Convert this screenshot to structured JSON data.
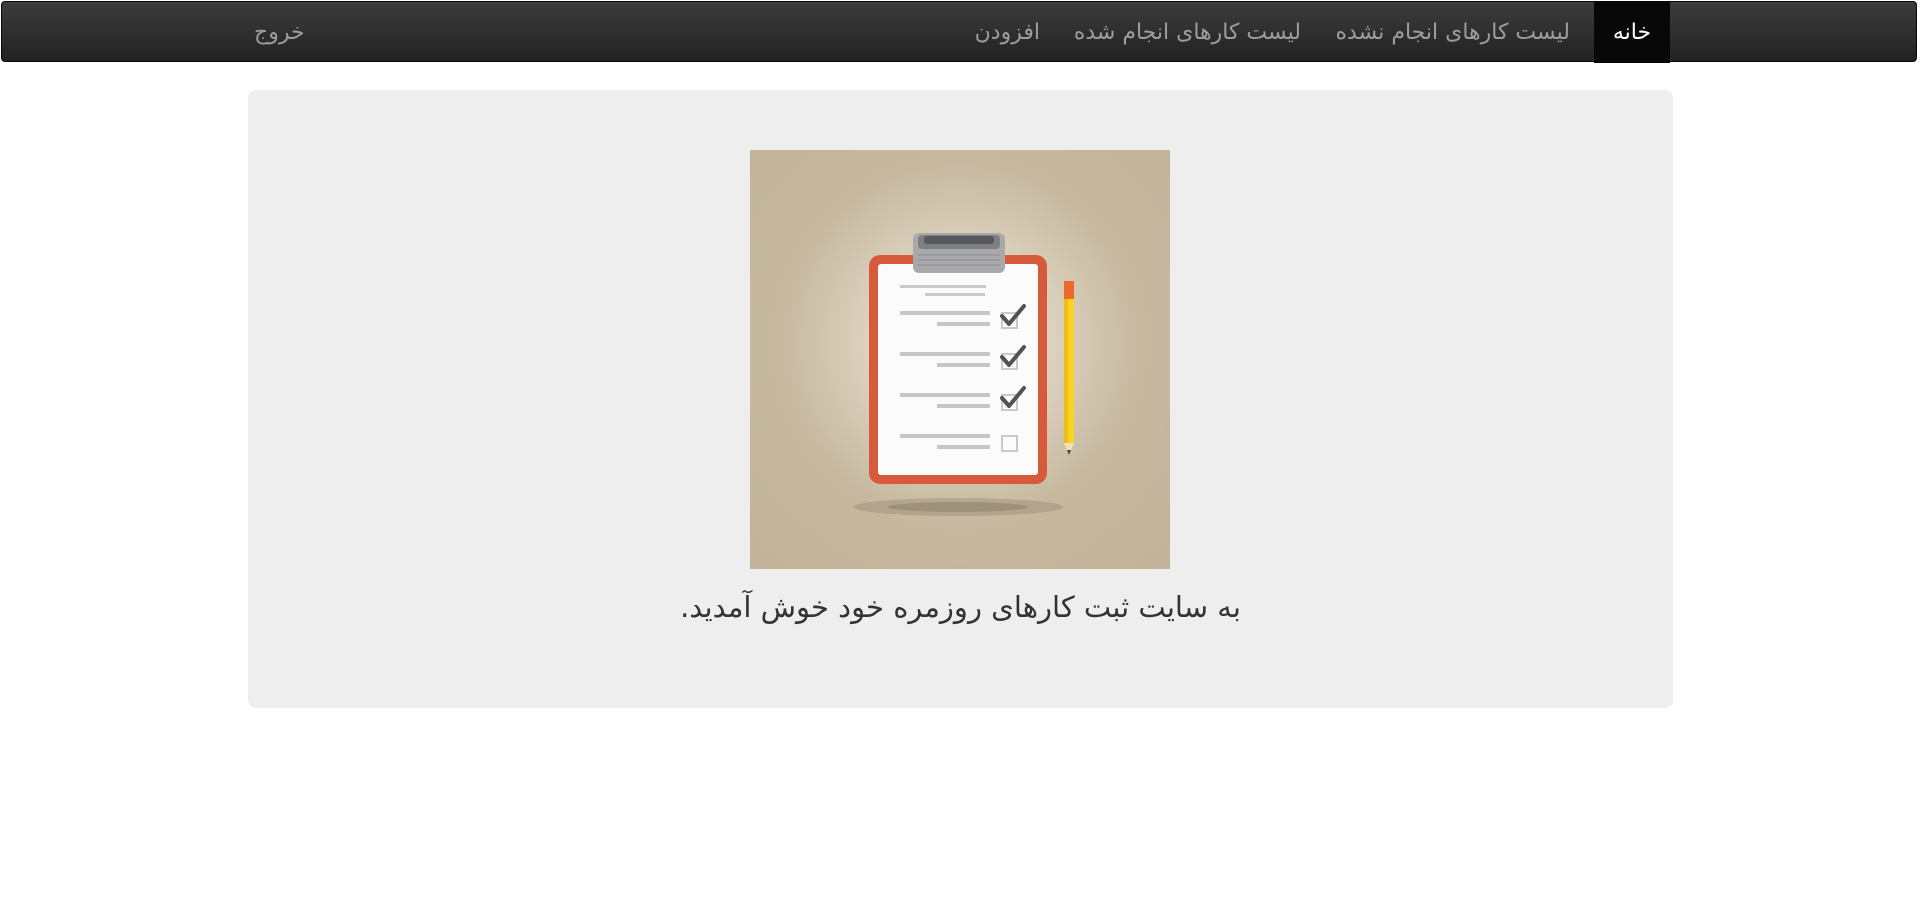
{
  "navbar": {
    "items": [
      {
        "label": "خانه",
        "active": true
      },
      {
        "label": "لیست کارهای انجام نشده",
        "active": false
      },
      {
        "label": "لیست کارهای انجام شده",
        "active": false
      },
      {
        "label": "افزودن",
        "active": false
      }
    ],
    "logout_label": "خروج"
  },
  "hero": {
    "image_icon": "clipboard-checklist-icon",
    "welcome_text": "به سایت ثبت کارهای روزمره خود خوش آمدید."
  },
  "colors": {
    "navbar_bg": "#222222",
    "nav_active_bg": "#080808",
    "nav_text": "#9d9d9d",
    "jumbotron_bg": "#eeeeee",
    "clipboard_border": "#d85a3c",
    "pencil": "#f5c518"
  }
}
